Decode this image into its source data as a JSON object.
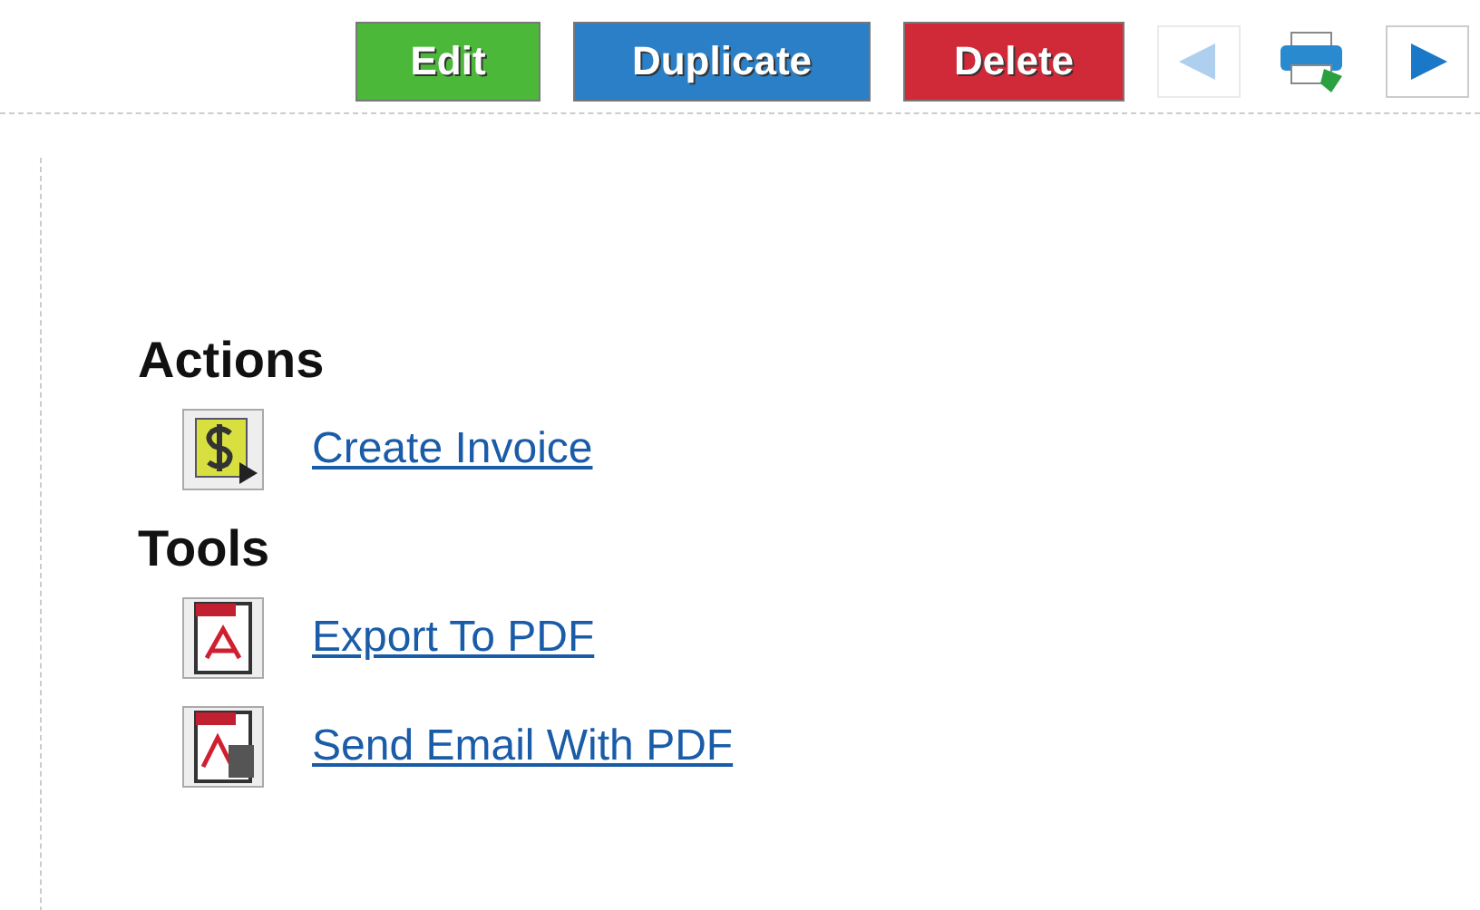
{
  "toolbar": {
    "buttons": [
      {
        "label": "Edit",
        "kind": "success"
      },
      {
        "label": "Duplicate",
        "kind": "primary"
      },
      {
        "label": "Delete",
        "kind": "danger"
      }
    ],
    "nav": [
      {
        "kind": "prev",
        "disabled": true
      },
      {
        "kind": "print",
        "disabled": false
      },
      {
        "kind": "next",
        "disabled": false
      }
    ]
  },
  "sections": [
    {
      "title": "Actions",
      "items": [
        {
          "kind": "invoice",
          "label": "Create Invoice"
        }
      ]
    },
    {
      "title": "Tools",
      "items": [
        {
          "kind": "pdf",
          "label": "Export To PDF"
        },
        {
          "kind": "pdf-email",
          "label": "Send Email With PDF"
        }
      ]
    }
  ]
}
